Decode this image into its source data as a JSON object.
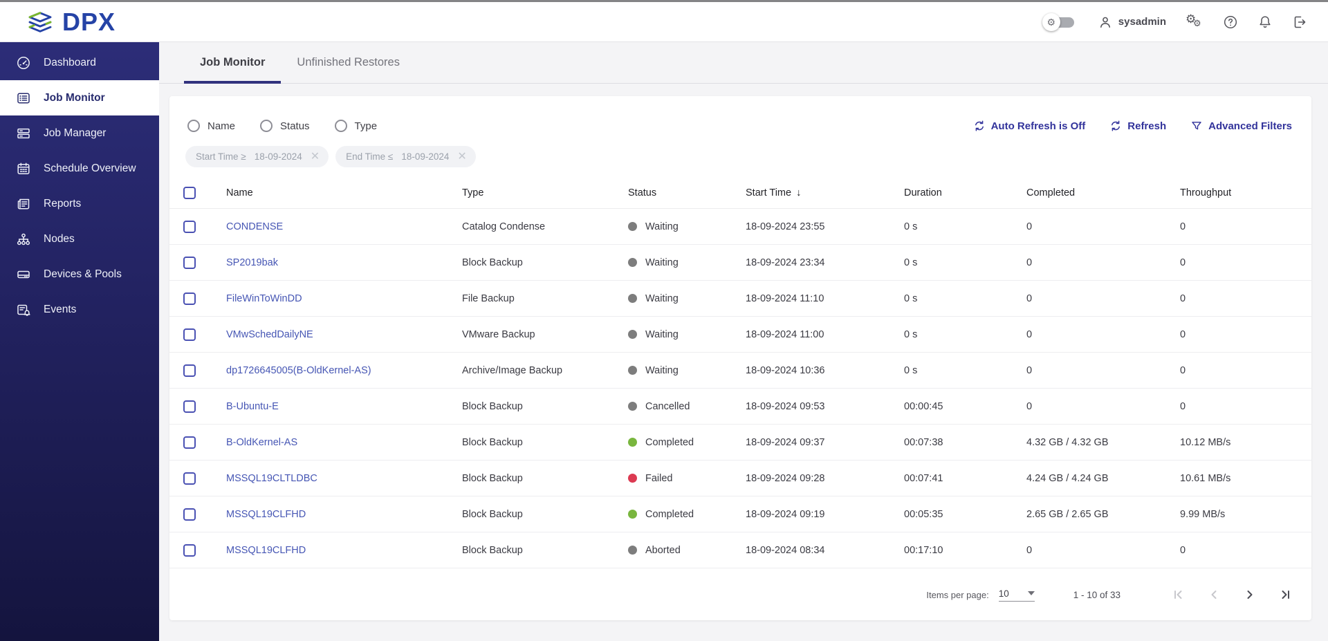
{
  "brand": {
    "name": "DPX"
  },
  "header": {
    "user": "sysadmin"
  },
  "sidebar": {
    "items": [
      {
        "label": "Dashboard",
        "icon": "gauge-icon",
        "active": false
      },
      {
        "label": "Job Monitor",
        "icon": "list-icon",
        "active": true
      },
      {
        "label": "Job Manager",
        "icon": "cards-icon",
        "active": false
      },
      {
        "label": "Schedule Overview",
        "icon": "calendar-icon",
        "active": false
      },
      {
        "label": "Reports",
        "icon": "newspaper-icon",
        "active": false
      },
      {
        "label": "Nodes",
        "icon": "sitemap-icon",
        "active": false
      },
      {
        "label": "Devices & Pools",
        "icon": "drive-icon",
        "active": false
      },
      {
        "label": "Events",
        "icon": "list-bell-icon",
        "active": false
      }
    ]
  },
  "tabs": [
    {
      "label": "Job Monitor",
      "active": true
    },
    {
      "label": "Unfinished Restores",
      "active": false
    }
  ],
  "filters": {
    "radios": [
      {
        "label": "Name"
      },
      {
        "label": "Status"
      },
      {
        "label": "Type"
      }
    ],
    "chips": [
      {
        "label": "Start Time ≥",
        "value": "18-09-2024"
      },
      {
        "label": "End Time ≤",
        "value": "18-09-2024"
      }
    ],
    "actions": [
      {
        "label": "Auto Refresh is Off",
        "icon": "refresh-icon"
      },
      {
        "label": "Refresh",
        "icon": "refresh-icon"
      },
      {
        "label": "Advanced Filters",
        "icon": "funnel-icon"
      }
    ]
  },
  "table": {
    "columns": [
      {
        "label": "Name"
      },
      {
        "label": "Type"
      },
      {
        "label": "Status"
      },
      {
        "label": "Start Time",
        "sort": "desc"
      },
      {
        "label": "Duration"
      },
      {
        "label": "Completed"
      },
      {
        "label": "Throughput"
      }
    ],
    "status_colors": {
      "Waiting": "#7d7d7d",
      "Cancelled": "#7d7d7d",
      "Aborted": "#7d7d7d",
      "Completed": "#79b63e",
      "Failed": "#dc3a52"
    },
    "rows": [
      {
        "name": "CONDENSE",
        "type": "Catalog Condense",
        "status": "Waiting",
        "start": "18-09-2024 23:55",
        "duration": "0 s",
        "completed": "0",
        "throughput": "0"
      },
      {
        "name": "SP2019bak",
        "type": "Block Backup",
        "status": "Waiting",
        "start": "18-09-2024 23:34",
        "duration": "0 s",
        "completed": "0",
        "throughput": "0"
      },
      {
        "name": "FileWinToWinDD",
        "type": "File Backup",
        "status": "Waiting",
        "start": "18-09-2024 11:10",
        "duration": "0 s",
        "completed": "0",
        "throughput": "0"
      },
      {
        "name": "VMwSchedDailyNE",
        "type": "VMware Backup",
        "status": "Waiting",
        "start": "18-09-2024 11:00",
        "duration": "0 s",
        "completed": "0",
        "throughput": "0"
      },
      {
        "name": "dp1726645005(B-OldKernel-AS)",
        "type": "Archive/Image Backup",
        "status": "Waiting",
        "start": "18-09-2024 10:36",
        "duration": "0 s",
        "completed": "0",
        "throughput": "0"
      },
      {
        "name": "B-Ubuntu-E",
        "type": "Block Backup",
        "status": "Cancelled",
        "start": "18-09-2024 09:53",
        "duration": "00:00:45",
        "completed": "0",
        "throughput": "0"
      },
      {
        "name": "B-OldKernel-AS",
        "type": "Block Backup",
        "status": "Completed",
        "start": "18-09-2024 09:37",
        "duration": "00:07:38",
        "completed": "4.32 GB / 4.32 GB",
        "throughput": "10.12 MB/s"
      },
      {
        "name": "MSSQL19CLTLDBC",
        "type": "Block Backup",
        "status": "Failed",
        "start": "18-09-2024 09:28",
        "duration": "00:07:41",
        "completed": "4.24 GB / 4.24 GB",
        "throughput": "10.61 MB/s"
      },
      {
        "name": "MSSQL19CLFHD",
        "type": "Block Backup",
        "status": "Completed",
        "start": "18-09-2024 09:19",
        "duration": "00:05:35",
        "completed": "2.65 GB / 2.65 GB",
        "throughput": "9.99 MB/s"
      },
      {
        "name": "MSSQL19CLFHD",
        "type": "Block Backup",
        "status": "Aborted",
        "start": "18-09-2024 08:34",
        "duration": "00:17:10",
        "completed": "0",
        "throughput": "0"
      }
    ]
  },
  "pagination": {
    "items_per_page_label": "Items per page:",
    "items_per_page": "10",
    "range": "1 - 10 of 33"
  }
}
